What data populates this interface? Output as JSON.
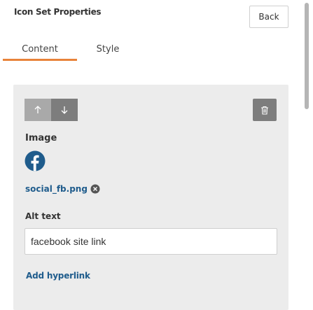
{
  "panel": {
    "title": "Icon Set Properties",
    "back_label": "Back"
  },
  "tabs": [
    {
      "label": "Content",
      "active": true
    },
    {
      "label": "Style",
      "active": false
    }
  ],
  "card": {
    "move_up_icon": "arrow-up-icon",
    "move_down_icon": "arrow-down-icon",
    "delete_icon": "trash-icon",
    "image_label": "Image",
    "image_icon": "facebook-icon",
    "file_name": "social_fb.png",
    "remove_icon": "close-circle-icon",
    "alt_label": "Alt text",
    "alt_value": "facebook site link",
    "add_link_label": "Add hyperlink"
  },
  "colors": {
    "accent": "#e8833a",
    "link": "#1f5c8c",
    "card_bg": "#ececec"
  }
}
